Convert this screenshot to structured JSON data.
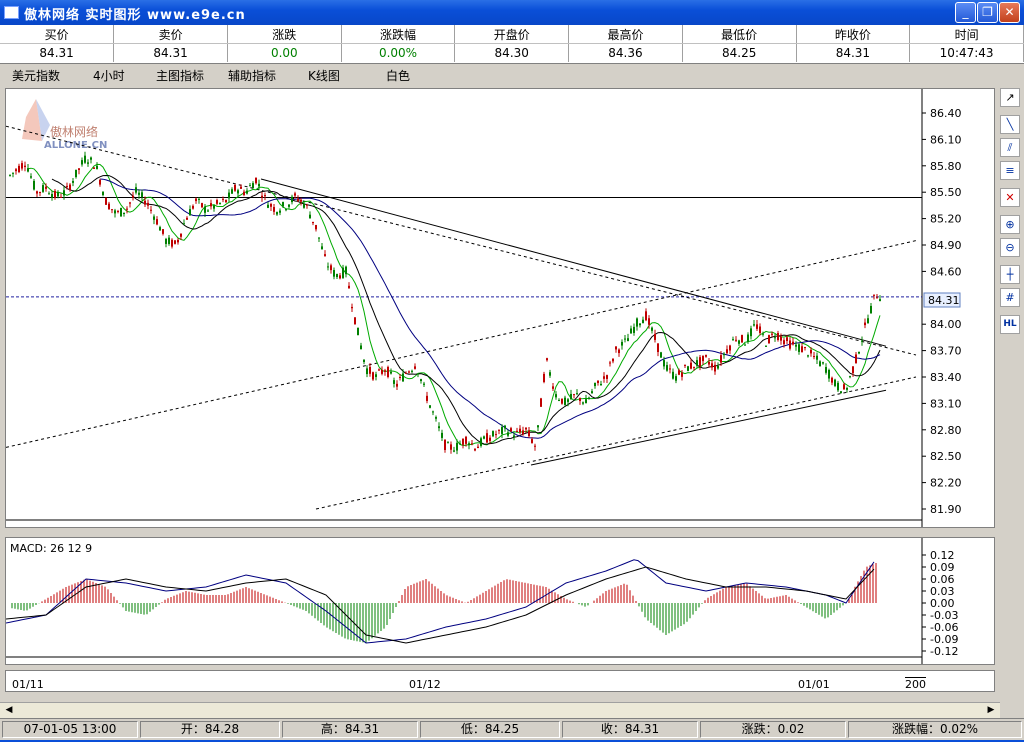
{
  "window": {
    "title": "傲林网络  实时图形  www.e9e.cn"
  },
  "quote": {
    "headers": [
      "买价",
      "卖价",
      "涨跌",
      "涨跌幅",
      "开盘价",
      "最高价",
      "最低价",
      "昨收价",
      "时间"
    ],
    "values": [
      "84.31",
      "84.31",
      "0.00",
      "0.00%",
      "84.30",
      "84.36",
      "84.25",
      "84.31",
      "10:47:43"
    ]
  },
  "menu": [
    "美元指数",
    "4小时",
    "主图指标",
    "辅助指标",
    "K线图",
    "白色"
  ],
  "chart_data": [
    {
      "type": "candlestick",
      "title": "美元指数 4小时",
      "watermark": {
        "cn": "傲林网络",
        "en": "ALLONE.CN"
      },
      "y_ticks": [
        "86.40",
        "86.10",
        "85.80",
        "85.50",
        "85.20",
        "84.90",
        "84.60",
        "84.00",
        "83.70",
        "83.40",
        "83.10",
        "82.80",
        "82.50",
        "82.20",
        "81.90"
      ],
      "last_price_label": "84.31",
      "ylim": [
        81.9,
        86.4
      ],
      "horizontal_line": 85.44,
      "price_path": [
        [
          0,
          85.65
        ],
        [
          10,
          85.75
        ],
        [
          20,
          85.85
        ],
        [
          30,
          85.5
        ],
        [
          40,
          85.55
        ],
        [
          50,
          85.45
        ],
        [
          60,
          85.5
        ],
        [
          70,
          85.7
        ],
        [
          80,
          85.9
        ],
        [
          90,
          85.8
        ],
        [
          100,
          85.4
        ],
        [
          110,
          85.25
        ],
        [
          120,
          85.3
        ],
        [
          130,
          85.5
        ],
        [
          140,
          85.4
        ],
        [
          150,
          85.2
        ],
        [
          160,
          84.95
        ],
        [
          170,
          84.9
        ],
        [
          180,
          85.2
        ],
        [
          190,
          85.4
        ],
        [
          200,
          85.3
        ],
        [
          210,
          85.35
        ],
        [
          220,
          85.4
        ],
        [
          230,
          85.55
        ],
        [
          240,
          85.5
        ],
        [
          250,
          85.65
        ],
        [
          260,
          85.4
        ],
        [
          270,
          85.3
        ],
        [
          280,
          85.35
        ],
        [
          290,
          85.45
        ],
        [
          300,
          85.35
        ],
        [
          310,
          85.1
        ],
        [
          320,
          84.7
        ],
        [
          330,
          84.55
        ],
        [
          340,
          84.6
        ],
        [
          350,
          84.0
        ],
        [
          360,
          83.5
        ],
        [
          370,
          83.4
        ],
        [
          380,
          83.5
        ],
        [
          390,
          83.3
        ],
        [
          400,
          83.45
        ],
        [
          410,
          83.55
        ],
        [
          420,
          83.2
        ],
        [
          430,
          82.9
        ],
        [
          440,
          82.6
        ],
        [
          450,
          82.6
        ],
        [
          460,
          82.7
        ],
        [
          470,
          82.6
        ],
        [
          480,
          82.7
        ],
        [
          490,
          82.75
        ],
        [
          500,
          82.8
        ],
        [
          510,
          82.75
        ],
        [
          520,
          82.8
        ],
        [
          530,
          82.6
        ],
        [
          540,
          83.6
        ],
        [
          550,
          83.2
        ],
        [
          560,
          83.1
        ],
        [
          570,
          83.2
        ],
        [
          580,
          83.1
        ],
        [
          590,
          83.3
        ],
        [
          600,
          83.4
        ],
        [
          610,
          83.7
        ],
        [
          620,
          83.8
        ],
        [
          630,
          84.0
        ],
        [
          640,
          84.1
        ],
        [
          650,
          83.8
        ],
        [
          660,
          83.5
        ],
        [
          670,
          83.4
        ],
        [
          680,
          83.5
        ],
        [
          690,
          83.55
        ],
        [
          700,
          83.6
        ],
        [
          710,
          83.5
        ],
        [
          720,
          83.7
        ],
        [
          730,
          83.85
        ],
        [
          740,
          83.8
        ],
        [
          750,
          84.0
        ],
        [
          760,
          83.8
        ],
        [
          770,
          83.9
        ],
        [
          780,
          83.8
        ],
        [
          790,
          83.75
        ],
        [
          800,
          83.7
        ],
        [
          810,
          83.6
        ],
        [
          820,
          83.5
        ],
        [
          830,
          83.3
        ],
        [
          840,
          83.25
        ],
        [
          850,
          83.6
        ],
        [
          860,
          84.0
        ],
        [
          870,
          84.35
        ],
        [
          875,
          84.31
        ]
      ],
      "trendlines": [
        {
          "style": "dashed",
          "from": [
            0,
            86.25
          ],
          "to": [
            910,
            83.65
          ]
        },
        {
          "style": "solid",
          "from": [
            255,
            85.65
          ],
          "to": [
            880,
            83.75
          ]
        },
        {
          "style": "dashed",
          "from": [
            0,
            82.6
          ],
          "to": [
            910,
            84.95
          ]
        },
        {
          "style": "solid",
          "from": [
            525,
            82.4
          ],
          "to": [
            880,
            83.25
          ]
        },
        {
          "style": "dashed",
          "from": [
            310,
            81.9
          ],
          "to": [
            910,
            83.4
          ]
        }
      ]
    },
    {
      "type": "bar",
      "title": "MACD: 26 12 9",
      "y_ticks": [
        "0.12",
        "0.09",
        "0.06",
        "0.03",
        "0.00",
        "-0.03",
        "-0.06",
        "-0.09",
        "-0.12"
      ],
      "ylim": [
        -0.13,
        0.13
      ],
      "histogram_path": [
        [
          0,
          -0.01
        ],
        [
          20,
          -0.02
        ],
        [
          40,
          0.01
        ],
        [
          60,
          0.04
        ],
        [
          80,
          0.06
        ],
        [
          100,
          0.04
        ],
        [
          120,
          -0.02
        ],
        [
          140,
          -0.03
        ],
        [
          160,
          0.01
        ],
        [
          180,
          0.03
        ],
        [
          200,
          0.02
        ],
        [
          220,
          0.02
        ],
        [
          240,
          0.04
        ],
        [
          260,
          0.02
        ],
        [
          280,
          0.0
        ],
        [
          300,
          -0.02
        ],
        [
          320,
          -0.06
        ],
        [
          340,
          -0.09
        ],
        [
          360,
          -0.1
        ],
        [
          380,
          -0.06
        ],
        [
          400,
          0.04
        ],
        [
          420,
          0.06
        ],
        [
          440,
          0.02
        ],
        [
          460,
          0.0
        ],
        [
          480,
          0.03
        ],
        [
          500,
          0.06
        ],
        [
          520,
          0.05
        ],
        [
          540,
          0.04
        ],
        [
          560,
          0.01
        ],
        [
          580,
          -0.01
        ],
        [
          600,
          0.03
        ],
        [
          620,
          0.05
        ],
        [
          640,
          -0.04
        ],
        [
          660,
          -0.08
        ],
        [
          680,
          -0.05
        ],
        [
          700,
          0.01
        ],
        [
          720,
          0.04
        ],
        [
          740,
          0.05
        ],
        [
          760,
          0.01
        ],
        [
          780,
          0.02
        ],
        [
          800,
          -0.01
        ],
        [
          820,
          -0.04
        ],
        [
          840,
          0.0
        ],
        [
          860,
          0.09
        ],
        [
          870,
          0.1
        ]
      ],
      "macd_path": [
        [
          0,
          -0.05
        ],
        [
          40,
          -0.03
        ],
        [
          80,
          0.06
        ],
        [
          120,
          0.05
        ],
        [
          160,
          0.03
        ],
        [
          200,
          0.04
        ],
        [
          240,
          0.07
        ],
        [
          280,
          0.05
        ],
        [
          320,
          -0.02
        ],
        [
          360,
          -0.1
        ],
        [
          400,
          -0.09
        ],
        [
          440,
          -0.06
        ],
        [
          480,
          -0.04
        ],
        [
          520,
          -0.01
        ],
        [
          560,
          0.05
        ],
        [
          600,
          0.08
        ],
        [
          630,
          0.11
        ],
        [
          660,
          0.05
        ],
        [
          700,
          0.03
        ],
        [
          740,
          0.05
        ],
        [
          780,
          0.04
        ],
        [
          820,
          0.02
        ],
        [
          840,
          -0.0
        ],
        [
          870,
          0.11
        ]
      ],
      "signal_path": [
        [
          0,
          -0.04
        ],
        [
          40,
          -0.03
        ],
        [
          80,
          0.04
        ],
        [
          120,
          0.06
        ],
        [
          160,
          0.04
        ],
        [
          200,
          0.03
        ],
        [
          240,
          0.05
        ],
        [
          280,
          0.06
        ],
        [
          320,
          0.02
        ],
        [
          360,
          -0.08
        ],
        [
          400,
          -0.1
        ],
        [
          440,
          -0.08
        ],
        [
          480,
          -0.06
        ],
        [
          520,
          -0.03
        ],
        [
          560,
          0.02
        ],
        [
          600,
          0.06
        ],
        [
          640,
          0.09
        ],
        [
          680,
          0.06
        ],
        [
          720,
          0.04
        ],
        [
          760,
          0.04
        ],
        [
          800,
          0.03
        ],
        [
          840,
          0.01
        ],
        [
          870,
          0.09
        ]
      ]
    }
  ],
  "xaxis": {
    "labels": [
      "01/11",
      "01/12",
      "01/01",
      "200"
    ]
  },
  "status": [
    {
      "text": "07-01-05 13:00"
    },
    {
      "text": "开：84.28"
    },
    {
      "text": "高：84.31"
    },
    {
      "text": "低：84.25"
    },
    {
      "text": "收：84.31"
    },
    {
      "text": "涨跌：0.02"
    },
    {
      "text": "涨跌幅：0.02%"
    }
  ],
  "colors": {
    "up": "#c00000",
    "down": "#008000",
    "ma_short": "#00aa00",
    "ma_long": "#000080",
    "ma_mid": "#000000"
  }
}
